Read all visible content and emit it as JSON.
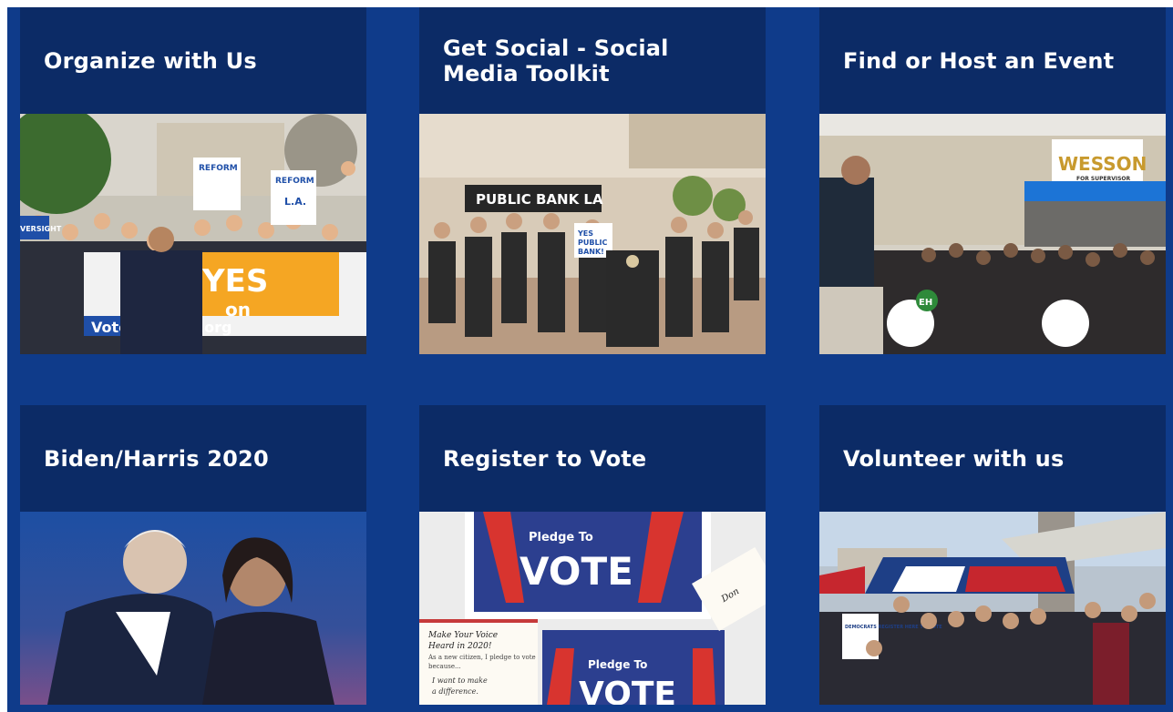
{
  "cards": [
    {
      "title": "Organize with Us",
      "image_text": {
        "reform_1": "REFORM",
        "reform_2": "REFORM",
        "la": "L.A.",
        "yes_on": "YES",
        "on": "on",
        "vote": "Vote",
        "org": ".org",
        "oversight": "VERSIGHT"
      }
    },
    {
      "title_line1": "Get Social - Social",
      "title_line2": "Media Toolkit",
      "image_text": {
        "banner": "PUBLIC BANK LA",
        "sign_yes": "YES",
        "sign_public": "PUBLIC",
        "sign_bank": "BANK!"
      }
    },
    {
      "title": "Find or Host an Event",
      "image_text": {
        "store_sign": "WESSON",
        "store_sub": "FOR SUPERVISOR",
        "shirt": "EH"
      }
    },
    {
      "title": "Biden/Harris 2020"
    },
    {
      "title": "Register to Vote",
      "image_text": {
        "pledge_1": "Pledge To",
        "vote_1": "VOTE",
        "pledge_2": "Pledge To",
        "vote_2": "VOTE",
        "card_line1": "Make Your Voice",
        "card_line2": "Heard in 2020!",
        "card_line3": "As a new citizen, I pledge to vote",
        "card_line4": "because...",
        "card_line5": "I want to make",
        "card_line6": "a difference.",
        "side_card": "Don"
      }
    },
    {
      "title": "Volunteer with us",
      "image_text": {
        "banner": "DEMOCRATS REGISTER HERE TO VOTE"
      }
    }
  ]
}
